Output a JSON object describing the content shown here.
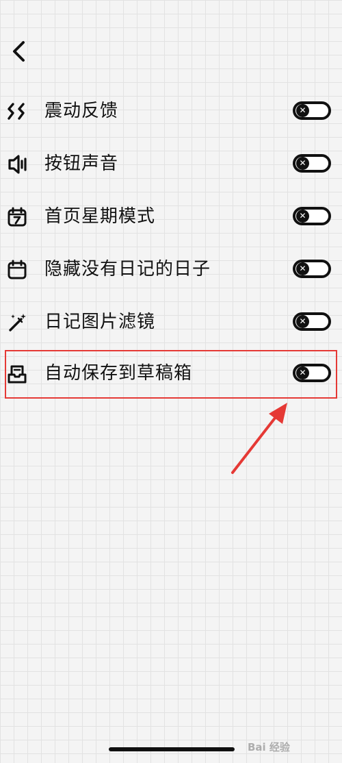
{
  "header": {
    "back_icon": "chevron-left-icon"
  },
  "settings": {
    "items": [
      {
        "label": "震动反馈",
        "icon": "vibration-icon",
        "toggle": "off"
      },
      {
        "label": "按钮声音",
        "icon": "speaker-icon",
        "toggle": "off"
      },
      {
        "label": "首页星期模式",
        "icon": "calendar-number-icon",
        "toggle": "off"
      },
      {
        "label": "隐藏没有日记的日子",
        "icon": "calendar-blank-icon",
        "toggle": "off"
      },
      {
        "label": "日记图片滤镜",
        "icon": "magic-wand-icon",
        "toggle": "off"
      },
      {
        "label": "自动保存到草稿箱",
        "icon": "drafts-tray-icon",
        "toggle": "off"
      }
    ]
  },
  "annotation": {
    "highlight_color": "#e53935",
    "highlighted_item": "自动保存到草稿箱"
  },
  "watermark": {
    "text": "Bai 经验"
  },
  "colors": {
    "ink": "#111111",
    "grid": "#e2e2e2",
    "background": "#f4f4f4",
    "annotation": "#e53935"
  }
}
